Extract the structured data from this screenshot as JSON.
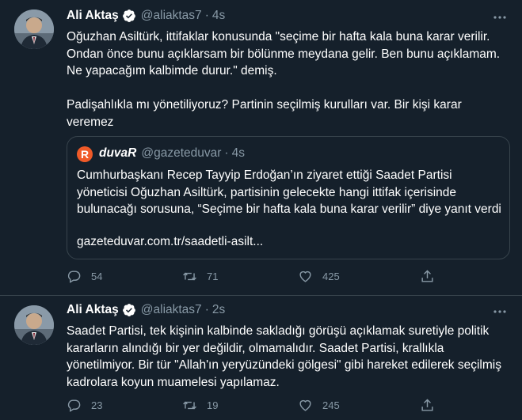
{
  "tweets": [
    {
      "name": "Ali Aktaş",
      "handle": "@aliaktas7",
      "time": "4s",
      "text": "Oğuzhan Asiltürk, ittifaklar konusunda \"seçime bir hafta kala buna karar verilir. Ondan önce bunu açıklarsam bir bölünme meydana gelir. Ben bunu açıklamam. Ne yapacağım kalbimde durur.\" demiş.\n\nPadişahlıkla mı yönetiliyoruz? Partinin seçilmiş kurulları var. Bir kişi karar veremez",
      "quote": {
        "avatar_letter": "R",
        "name": "duvaR",
        "handle": "@gazeteduvar",
        "time": "4s",
        "text": "Cumhurbaşkanı Recep Tayyip Erdoğan’ın ziyaret ettiği Saadet Partisi yöneticisi Oğuzhan Asiltürk, partisinin gelecekte hangi ittifak içerisinde bulunacağı sorusuna, “Seçime bir hafta kala buna karar verilir” diye yanıt verdi",
        "link": "gazeteduvar.com.tr/saadetli-asilt..."
      },
      "replies": "54",
      "retweets": "71",
      "likes": "425"
    },
    {
      "name": "Ali Aktaş",
      "handle": "@aliaktas7",
      "time": "2s",
      "text": "Saadet Partisi, tek kişinin kalbinde sakladığı görüşü açıklamak suretiyle politik kararların alındığı bir yer değildir, olmamalıdır. Saadet Partisi, krallıkla yönetilmiyor. Bir tür \"Allah'ın yeryüzündeki gölgesi\" gibi hareket edilerek seçilmiş kadrolara koyun muamelesi yapılamaz.",
      "replies": "23",
      "retweets": "19",
      "likes": "245"
    }
  ],
  "separator": "·",
  "colors": {
    "background": "#15202b",
    "border": "#38444d",
    "muted": "#8899a6",
    "verified": "#1da1f2",
    "duvar_brand": "#f05a28"
  }
}
